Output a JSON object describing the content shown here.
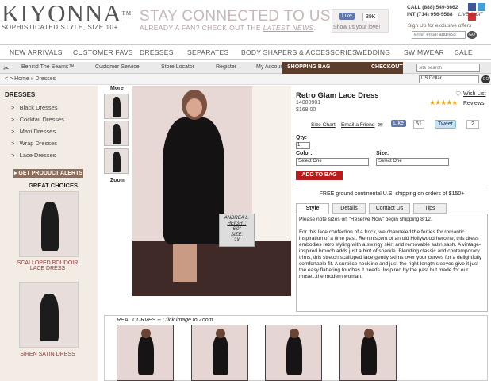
{
  "header": {
    "logo": "KIYONNA",
    "logo_tm": "TM",
    "tagline": "SOPHISTICATED STYLE, SIZE 10+",
    "stay": "STAY CONNECTED TO US!",
    "fan_prefix": "ALREADY A FAN? CHECK OUT THE ",
    "fan_link": "LATEST NEWS",
    "fan_suffix": ".",
    "fb_like": "Like",
    "fb_count": "39K",
    "show_love": "Show us your love!",
    "call": "CALL (888) 549-6662",
    "intl": "INT (714) 956-5588",
    "live_chat": "LIVE CHAT",
    "signup": "Sign Up for exclusive offers",
    "email_placeholder": "enter email address",
    "go": "GO"
  },
  "nav": [
    "NEW ARRIVALS",
    "CUSTOMER FAVS",
    "DRESSES",
    "SEPARATES",
    "BODY SHAPERS & ACCESSORIES",
    "WEDDING",
    "SWIMWEAR",
    "SALE"
  ],
  "subnav": {
    "seams": "Behind The Seams™",
    "service": "Customer Service",
    "store": "Store Locator",
    "register": "Register",
    "account": "My Account",
    "bag": "SHOPPING BAG",
    "checkout": "CHECKOUT",
    "search_placeholder": "site search"
  },
  "breadcrumb": "<  >  Home » Dresses",
  "currency": "US Dollar",
  "sidebar": {
    "title": "DRESSES",
    "links": [
      "Black Dresses",
      "Cocktail Dresses",
      "Maxi Dresses",
      "Wrap Dresses",
      "Lace Dresses"
    ],
    "alerts": "GET PRODUCT ALERTS",
    "great": "GREAT CHOICES",
    "choice1": "SCALLOPED BOUDOIR LACE DRESS",
    "choice2": "SIREN SATIN DRESS"
  },
  "gallery": {
    "more": "More",
    "zoom": "Zoom",
    "model_name": "ANDREA L.",
    "height_label": "HEIGHT:",
    "height": "6'0\"",
    "size_label": "SIZE:",
    "size": "2X"
  },
  "product": {
    "title": "Retro Glam Lace Dress",
    "sku": "14080901",
    "price": "$168.00",
    "wish": "Wish List",
    "stars": "★★★★★",
    "reviews": "Reviews",
    "size_chart": "Size Chart",
    "email_friend": "Email a Friend",
    "like": "Like",
    "like_count": "51",
    "tweet": "Tweet",
    "tweet_count": "2",
    "qty_label": "Qty:",
    "qty": "1",
    "color_label": "Color:",
    "size_label": "Size:",
    "select_one": "Select One",
    "add": "ADD TO BAG",
    "shipping": "FREE ground continental U.S. shipping on orders of $150+"
  },
  "tabs": [
    "Style",
    "Details",
    "Contact Us",
    "Tips"
  ],
  "desc": {
    "note": "Please note sizes on \"Reserve Now\" begin shipping 8/12.",
    "body": "For this lace confection of a frock, we channeled the forties for romantic inspiration of a time past. Reminiscent of an old Hollywood heroine, this dress embodies retro styling with a swingy skirt and removable satin sash. A vintage-inspired brooch adds just a hint of sparkle. Blending classic and contemporary trims, this stretch scalloped lace gently skims over your curves for a delightfully comfortable fit. A surplice neckline and just-the-right-length sleeves give it just the easy flattering touches it needs. Inspired by the past but made for our muse...the modern woman."
  },
  "real_curves": "REAL CURVES -- Click image to Zoom.",
  "colors": {
    "brown": "#5a3d2b",
    "red": "#b81c1c",
    "sidebar": "#f3ece4"
  }
}
